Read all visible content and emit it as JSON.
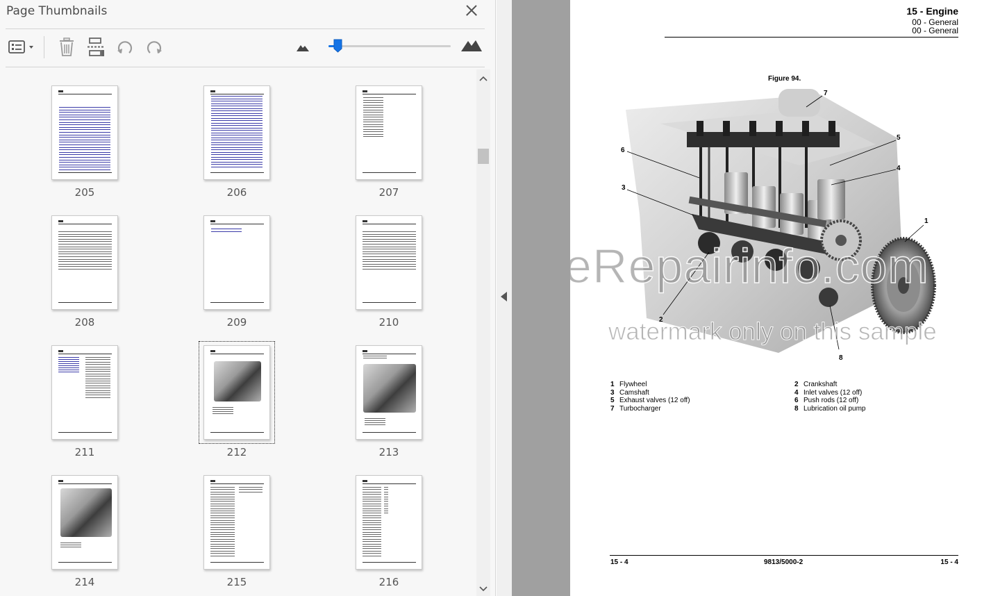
{
  "panel": {
    "title": "Page Thumbnails",
    "toolbar": {
      "options": "options-menu-icon",
      "delete": "trash-icon",
      "insert": "insert-page-icon",
      "rotate_ccw": "rotate-counterclockwise-icon",
      "rotate_cw": "rotate-clockwise-icon",
      "zoom_small": "mountain-small-icon",
      "zoom_large": "mountain-large-icon"
    },
    "zoom_level": 0.04,
    "accent_color": "#1473e6",
    "thumbnails": [
      {
        "page": "205",
        "kind": "toc"
      },
      {
        "page": "206",
        "kind": "toc2"
      },
      {
        "page": "207",
        "kind": "list"
      },
      {
        "page": "208",
        "kind": "lines"
      },
      {
        "page": "209",
        "kind": "blank"
      },
      {
        "page": "210",
        "kind": "lines"
      },
      {
        "page": "211",
        "kind": "twocol"
      },
      {
        "page": "212",
        "kind": "figure",
        "selected": true
      },
      {
        "page": "213",
        "kind": "figure2"
      },
      {
        "page": "214",
        "kind": "figure3"
      },
      {
        "page": "215",
        "kind": "text"
      },
      {
        "page": "216",
        "kind": "table"
      }
    ]
  },
  "document": {
    "header_title": "15 - Engine",
    "header_sub1": "00 - General",
    "header_sub2": "00 - General",
    "figure_title": "Figure 94.",
    "callouts": [
      "1",
      "2",
      "3",
      "4",
      "5",
      "6",
      "7",
      "8"
    ],
    "legend": [
      {
        "n": "1",
        "label": "Flywheel"
      },
      {
        "n": "2",
        "label": "Crankshaft"
      },
      {
        "n": "3",
        "label": "Camshaft"
      },
      {
        "n": "4",
        "label": "Inlet valves (12 off)"
      },
      {
        "n": "5",
        "label": "Exhaust valves (12 off)"
      },
      {
        "n": "6",
        "label": "Push rods (12 off)"
      },
      {
        "n": "7",
        "label": "Turbocharger"
      },
      {
        "n": "8",
        "label": "Lubrication oil pump"
      }
    ],
    "watermark_line1": "eRepairinfo.com",
    "watermark_line2": "watermark only on this sample",
    "footer_left": "15 - 4",
    "footer_center": "9813/5000-2",
    "footer_right": "15 - 4"
  }
}
